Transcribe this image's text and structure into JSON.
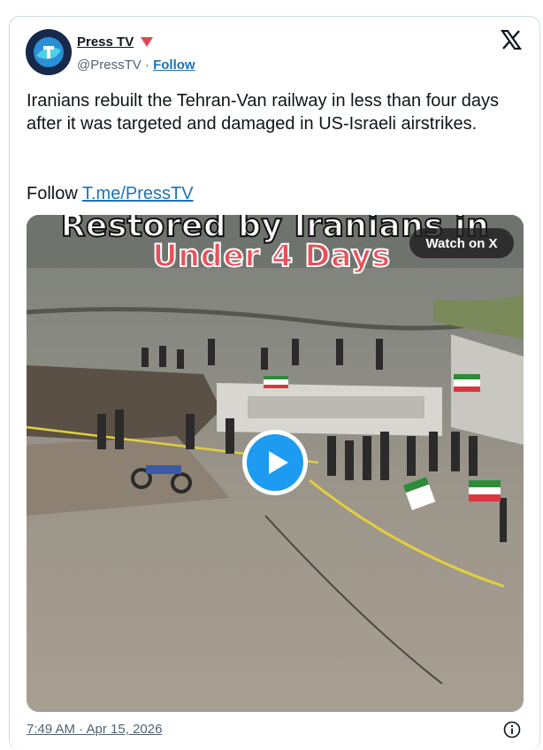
{
  "tweet": {
    "display_name": "Press TV",
    "verified_badge_icon": "red-triangle-badge-icon",
    "handle": "@PressTV",
    "separator": "·",
    "follow_label": "Follow",
    "body": "Iranians rebuilt the Tehran-Van railway in less than four days after it was targeted and damaged in US-Israeli airstrikes.",
    "follow_prefix": "Follow",
    "link_text": "T.me/PressTV",
    "timestamp": "7:49 AM · Apr 15, 2026"
  },
  "media": {
    "overlay_line1": "Restored by Iranians in",
    "overlay_line2": "Under 4 Days",
    "watch_label": "Watch on X",
    "play_icon": "play-icon"
  },
  "icons": {
    "x_logo": "x-logo-icon",
    "info": "info-icon"
  },
  "colors": {
    "link_blue": "#1d72b8",
    "play_blue": "#1d9bf0",
    "overlay_red": "#e8515a",
    "muted_gray": "#536471"
  }
}
